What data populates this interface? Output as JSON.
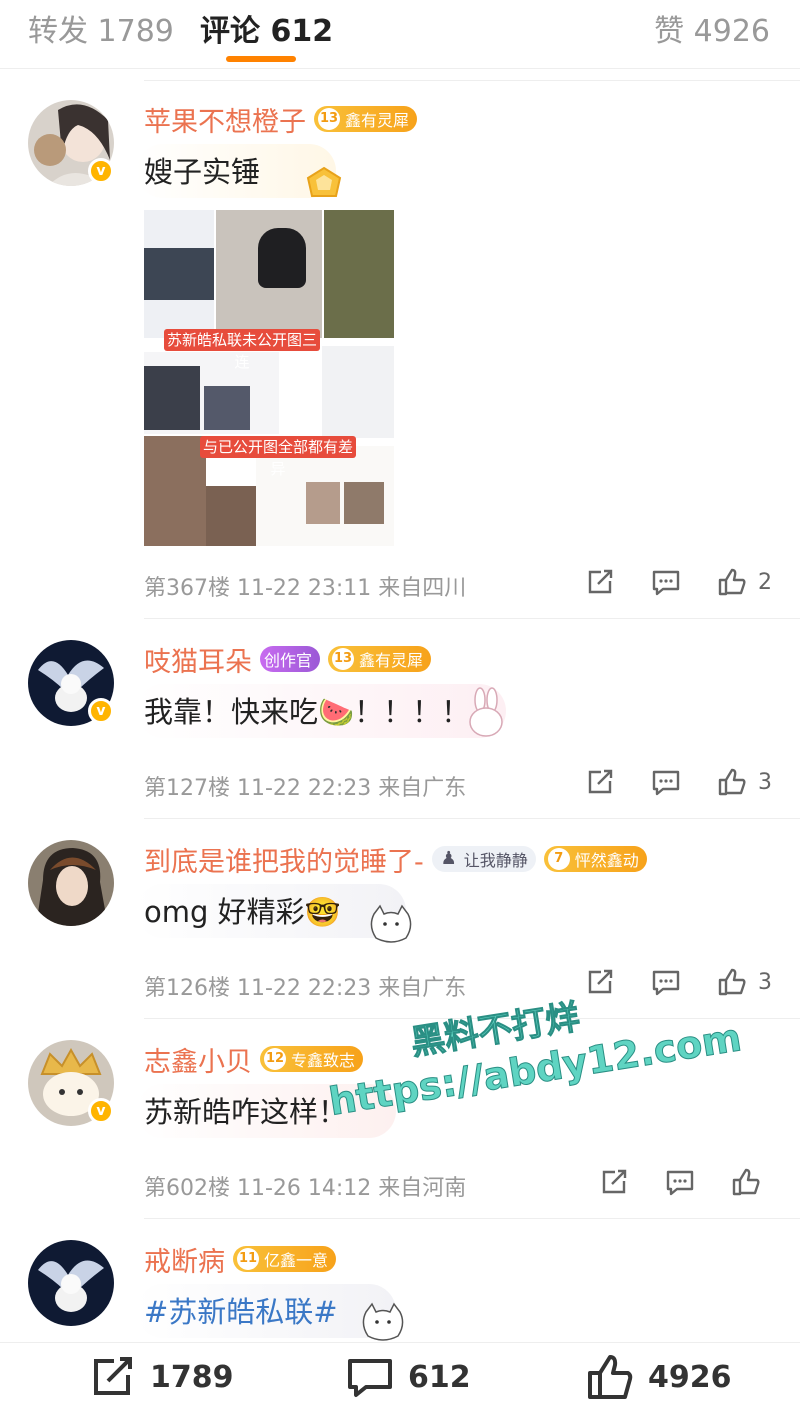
{
  "tabs": {
    "repost_label": "转发 1789",
    "comments_label": "评论 612",
    "likes_label": "赞 4926"
  },
  "comments": [
    {
      "username": "苹果不想橙子",
      "badges": [
        {
          "level": "13",
          "text": "鑫有灵犀"
        }
      ],
      "text": "嫂子实锤",
      "image_labels": [
        "苏新皓私联未公开图三连",
        "与已公开图全部都有差异"
      ],
      "meta": "第367楼 11-22 23:11 来自四川",
      "likes": "2"
    },
    {
      "username": "吱猫耳朵",
      "badges": [
        {
          "level": "",
          "text": "创作官"
        },
        {
          "level": "13",
          "text": "鑫有灵犀"
        }
      ],
      "text": "我靠！快来吃🍉！！！！",
      "meta": "第127楼 11-22 22:23 来自广东",
      "likes": "3"
    },
    {
      "username": "到底是谁把我的觉睡了-",
      "badges": [
        {
          "level": "",
          "text": "让我静静"
        },
        {
          "level": "7",
          "text": "怦然鑫动"
        }
      ],
      "text": "omg 好精彩🤓",
      "meta": "第126楼 11-22 22:23 来自广东",
      "likes": "3"
    },
    {
      "username": "志鑫小贝",
      "badges": [
        {
          "level": "12",
          "text": "专鑫致志"
        }
      ],
      "text": "苏新皓咋这样！",
      "meta": "第602楼 11-26 14:12 来自河南",
      "likes": ""
    },
    {
      "username": "戒断病",
      "badges": [
        {
          "level": "11",
          "text": "亿鑫一意"
        }
      ],
      "text": "#苏新皓私联#"
    }
  ],
  "watermark": {
    "line1": "黑料不打烊",
    "line2": "https://abdy12.com"
  },
  "bottom_bar": {
    "repost_count": "1789",
    "comment_count": "612",
    "like_count": "4926"
  },
  "colors": {
    "accent": "#ff8200",
    "username": "#eb7350",
    "badge": "#f7a21a",
    "hashtag": "#3b78c6"
  }
}
